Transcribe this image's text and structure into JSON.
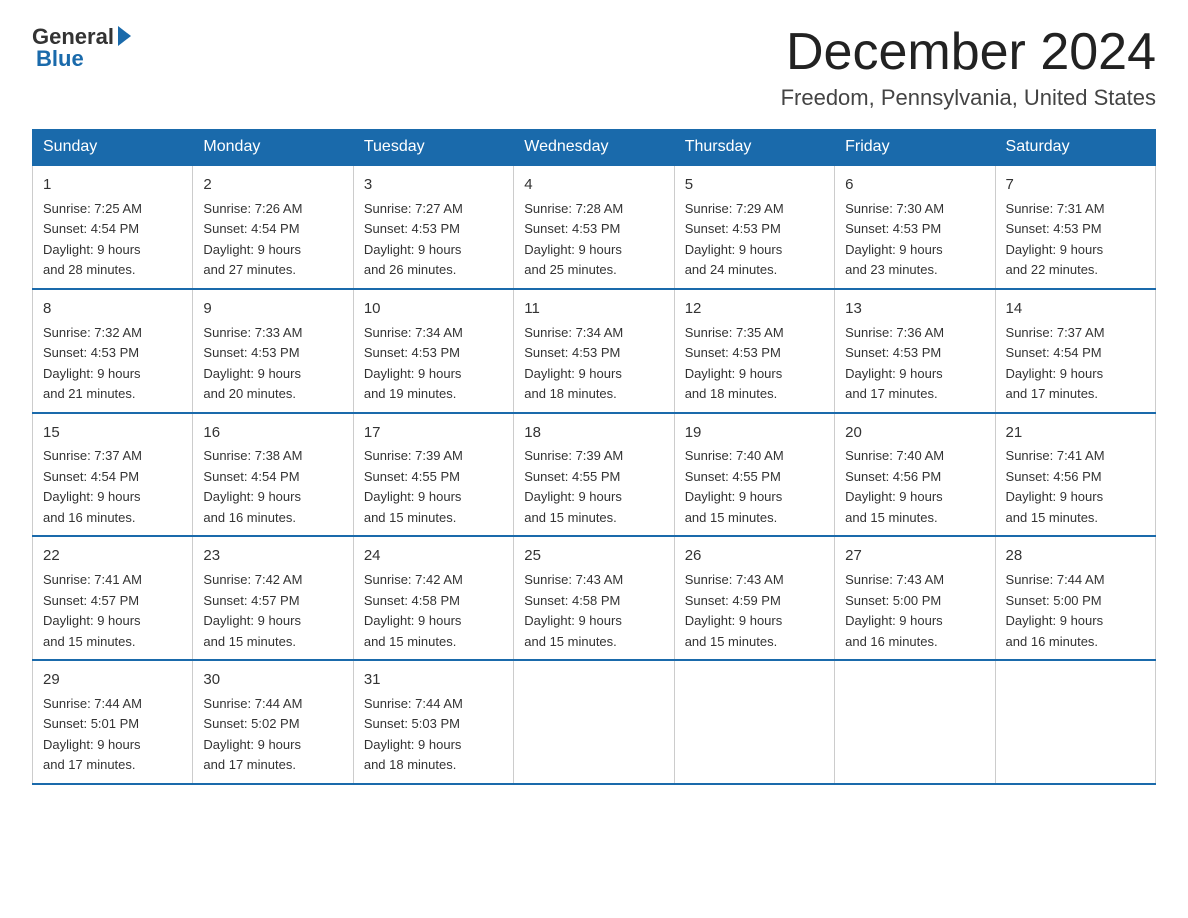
{
  "logo": {
    "general": "General",
    "blue": "Blue"
  },
  "title": "December 2024",
  "location": "Freedom, Pennsylvania, United States",
  "days_of_week": [
    "Sunday",
    "Monday",
    "Tuesday",
    "Wednesday",
    "Thursday",
    "Friday",
    "Saturday"
  ],
  "weeks": [
    [
      {
        "day": "1",
        "sunrise": "7:25 AM",
        "sunset": "4:54 PM",
        "daylight": "9 hours and 28 minutes."
      },
      {
        "day": "2",
        "sunrise": "7:26 AM",
        "sunset": "4:54 PM",
        "daylight": "9 hours and 27 minutes."
      },
      {
        "day": "3",
        "sunrise": "7:27 AM",
        "sunset": "4:53 PM",
        "daylight": "9 hours and 26 minutes."
      },
      {
        "day": "4",
        "sunrise": "7:28 AM",
        "sunset": "4:53 PM",
        "daylight": "9 hours and 25 minutes."
      },
      {
        "day": "5",
        "sunrise": "7:29 AM",
        "sunset": "4:53 PM",
        "daylight": "9 hours and 24 minutes."
      },
      {
        "day": "6",
        "sunrise": "7:30 AM",
        "sunset": "4:53 PM",
        "daylight": "9 hours and 23 minutes."
      },
      {
        "day": "7",
        "sunrise": "7:31 AM",
        "sunset": "4:53 PM",
        "daylight": "9 hours and 22 minutes."
      }
    ],
    [
      {
        "day": "8",
        "sunrise": "7:32 AM",
        "sunset": "4:53 PM",
        "daylight": "9 hours and 21 minutes."
      },
      {
        "day": "9",
        "sunrise": "7:33 AM",
        "sunset": "4:53 PM",
        "daylight": "9 hours and 20 minutes."
      },
      {
        "day": "10",
        "sunrise": "7:34 AM",
        "sunset": "4:53 PM",
        "daylight": "9 hours and 19 minutes."
      },
      {
        "day": "11",
        "sunrise": "7:34 AM",
        "sunset": "4:53 PM",
        "daylight": "9 hours and 18 minutes."
      },
      {
        "day": "12",
        "sunrise": "7:35 AM",
        "sunset": "4:53 PM",
        "daylight": "9 hours and 18 minutes."
      },
      {
        "day": "13",
        "sunrise": "7:36 AM",
        "sunset": "4:53 PM",
        "daylight": "9 hours and 17 minutes."
      },
      {
        "day": "14",
        "sunrise": "7:37 AM",
        "sunset": "4:54 PM",
        "daylight": "9 hours and 17 minutes."
      }
    ],
    [
      {
        "day": "15",
        "sunrise": "7:37 AM",
        "sunset": "4:54 PM",
        "daylight": "9 hours and 16 minutes."
      },
      {
        "day": "16",
        "sunrise": "7:38 AM",
        "sunset": "4:54 PM",
        "daylight": "9 hours and 16 minutes."
      },
      {
        "day": "17",
        "sunrise": "7:39 AM",
        "sunset": "4:55 PM",
        "daylight": "9 hours and 15 minutes."
      },
      {
        "day": "18",
        "sunrise": "7:39 AM",
        "sunset": "4:55 PM",
        "daylight": "9 hours and 15 minutes."
      },
      {
        "day": "19",
        "sunrise": "7:40 AM",
        "sunset": "4:55 PM",
        "daylight": "9 hours and 15 minutes."
      },
      {
        "day": "20",
        "sunrise": "7:40 AM",
        "sunset": "4:56 PM",
        "daylight": "9 hours and 15 minutes."
      },
      {
        "day": "21",
        "sunrise": "7:41 AM",
        "sunset": "4:56 PM",
        "daylight": "9 hours and 15 minutes."
      }
    ],
    [
      {
        "day": "22",
        "sunrise": "7:41 AM",
        "sunset": "4:57 PM",
        "daylight": "9 hours and 15 minutes."
      },
      {
        "day": "23",
        "sunrise": "7:42 AM",
        "sunset": "4:57 PM",
        "daylight": "9 hours and 15 minutes."
      },
      {
        "day": "24",
        "sunrise": "7:42 AM",
        "sunset": "4:58 PM",
        "daylight": "9 hours and 15 minutes."
      },
      {
        "day": "25",
        "sunrise": "7:43 AM",
        "sunset": "4:58 PM",
        "daylight": "9 hours and 15 minutes."
      },
      {
        "day": "26",
        "sunrise": "7:43 AM",
        "sunset": "4:59 PM",
        "daylight": "9 hours and 15 minutes."
      },
      {
        "day": "27",
        "sunrise": "7:43 AM",
        "sunset": "5:00 PM",
        "daylight": "9 hours and 16 minutes."
      },
      {
        "day": "28",
        "sunrise": "7:44 AM",
        "sunset": "5:00 PM",
        "daylight": "9 hours and 16 minutes."
      }
    ],
    [
      {
        "day": "29",
        "sunrise": "7:44 AM",
        "sunset": "5:01 PM",
        "daylight": "9 hours and 17 minutes."
      },
      {
        "day": "30",
        "sunrise": "7:44 AM",
        "sunset": "5:02 PM",
        "daylight": "9 hours and 17 minutes."
      },
      {
        "day": "31",
        "sunrise": "7:44 AM",
        "sunset": "5:03 PM",
        "daylight": "9 hours and 18 minutes."
      },
      null,
      null,
      null,
      null
    ]
  ],
  "labels": {
    "sunrise": "Sunrise:",
    "sunset": "Sunset:",
    "daylight": "Daylight:"
  }
}
